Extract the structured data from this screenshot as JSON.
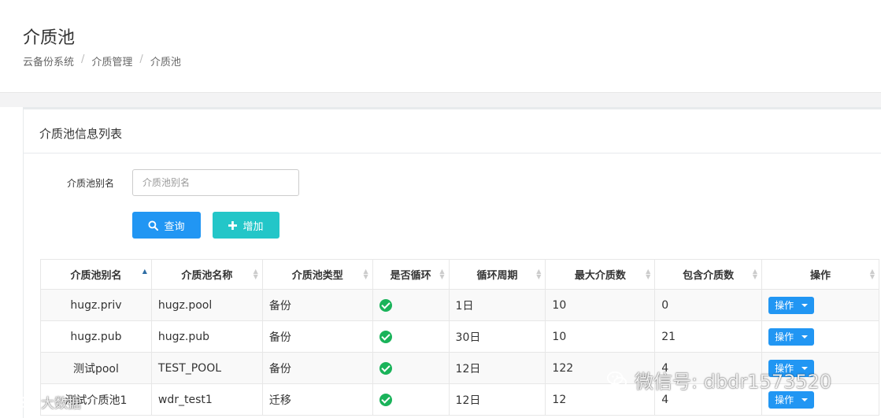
{
  "header": {
    "title": "介质池",
    "breadcrumb": [
      "云备份系统",
      "介质管理",
      "介质池"
    ]
  },
  "panel": {
    "title": "介质池信息列表"
  },
  "filter": {
    "label": "介质池别名",
    "placeholder": "介质池别名",
    "query_label": "查询",
    "add_label": "增加"
  },
  "table": {
    "columns": [
      "介质池别名",
      "介质池名称",
      "介质池类型",
      "是否循环",
      "循环周期",
      "最大介质数",
      "包含介质数",
      "操作"
    ],
    "rows": [
      {
        "alias": "hugz.priv",
        "name": "hugz.pool",
        "type": "备份",
        "cycle": true,
        "period": "1日",
        "max": "10",
        "count": "0",
        "op": "操作"
      },
      {
        "alias": "hugz.pub",
        "name": "hugz.pub",
        "type": "备份",
        "cycle": true,
        "period": "30日",
        "max": "10",
        "count": "21",
        "op": "操作"
      },
      {
        "alias": "测试pool",
        "name": "TEST_POOL",
        "type": "备份",
        "cycle": true,
        "period": "12日",
        "max": "122",
        "count": "4",
        "op": "操作"
      },
      {
        "alias": "测试介质池1",
        "name": "wdr_test1",
        "type": "迁移",
        "cycle": true,
        "period": "12日",
        "max": "12",
        "count": "4",
        "op": "操作"
      }
    ]
  },
  "watermarks": {
    "right": "微信号: dbdr1573520",
    "left": "大数据"
  },
  "colors": {
    "primary": "#2196f3",
    "add": "#23c6c8",
    "success": "#1ab35a"
  }
}
